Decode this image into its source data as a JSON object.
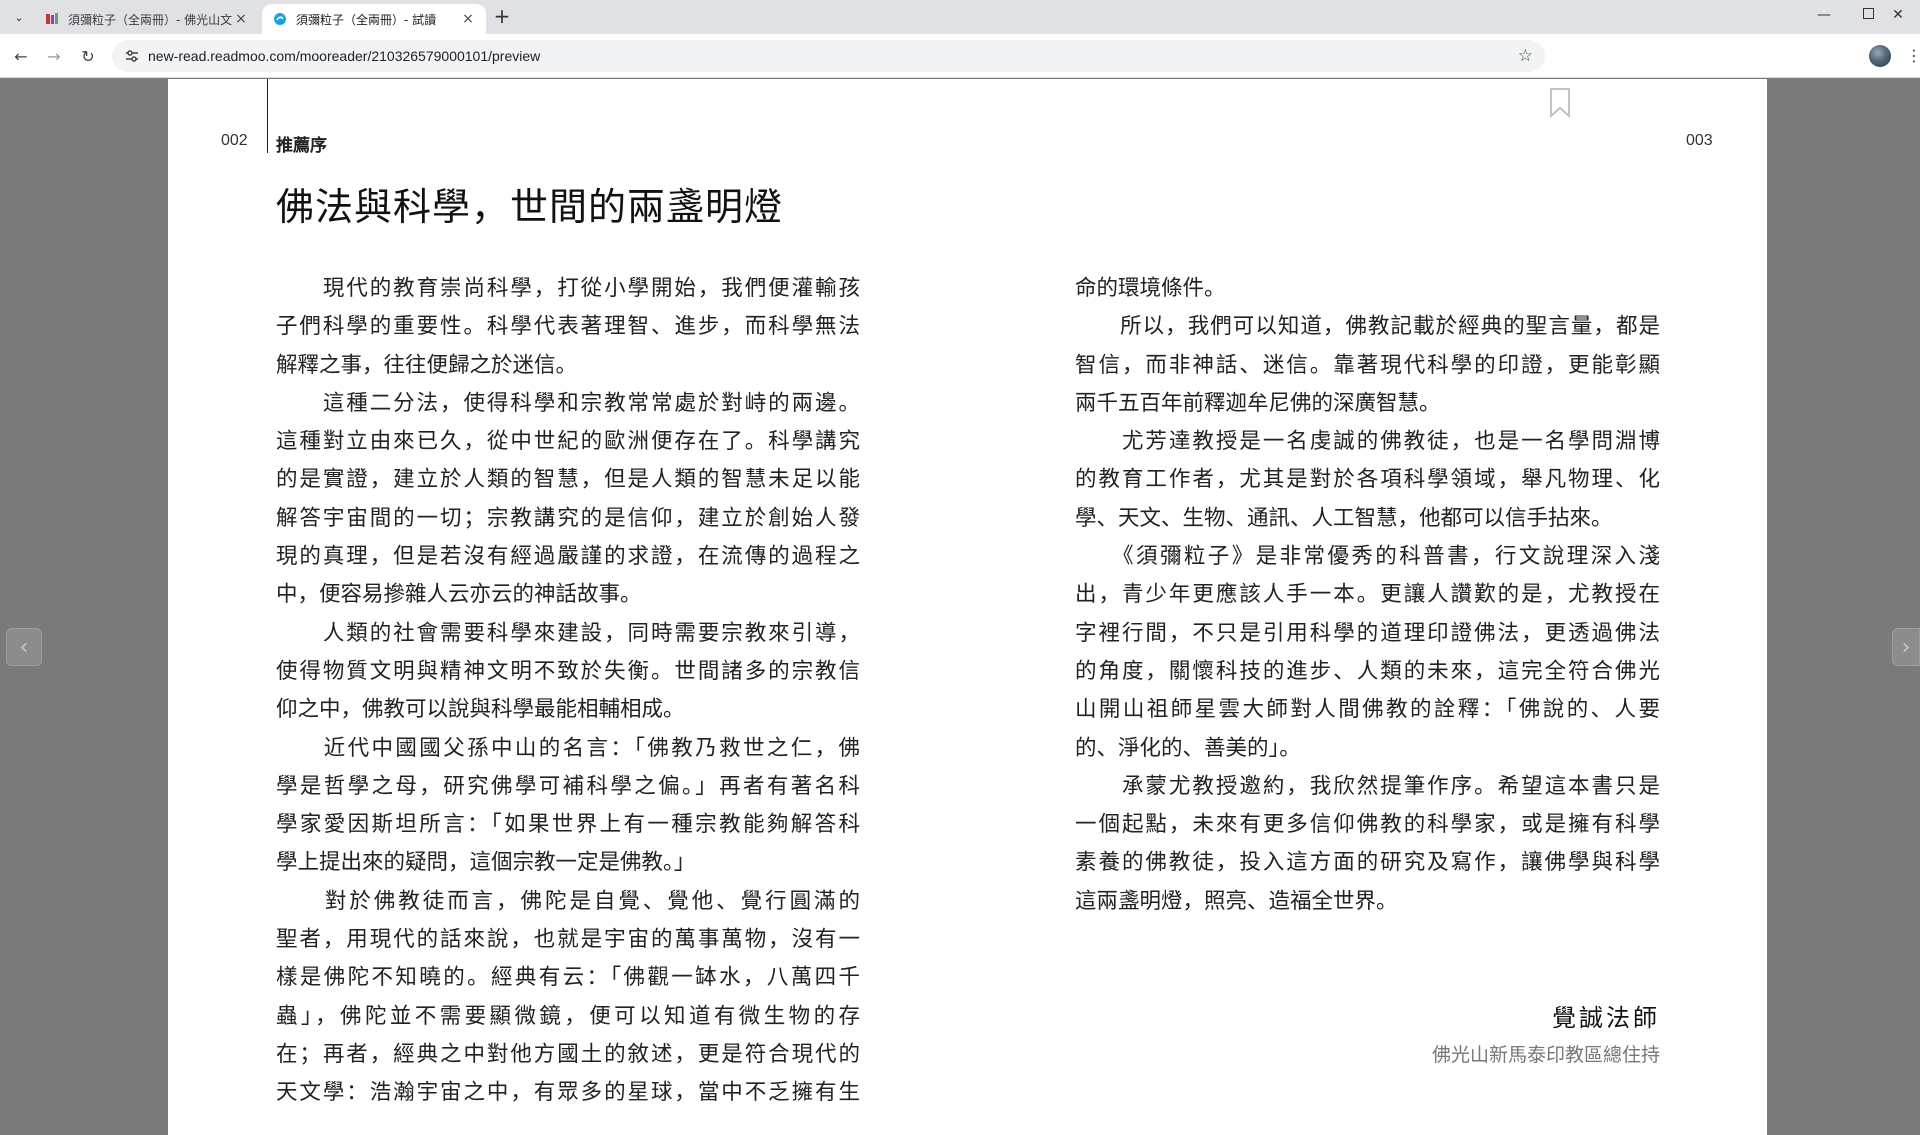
{
  "browser": {
    "tabs": [
      {
        "title": "須彌粒子（全兩冊）- 佛光山文",
        "active": false
      },
      {
        "title": "須彌粒子（全兩冊）- 試讀",
        "active": true
      }
    ],
    "url": "new-read.readmoo.com/mooreader/210326579000101/preview"
  },
  "reader": {
    "left_page_number": "002",
    "right_page_number": "003",
    "section_label": "推薦序",
    "chapter_title": "佛法與科學，世間的兩盞明燈",
    "left_column": [
      {
        "text": "　　現代的教育崇尚科學，打從小學開始，我們便灌輸孩",
        "short": false
      },
      {
        "text": "子們科學的重要性。科學代表著理智、進步，而科學無法",
        "short": false
      },
      {
        "text": "解釋之事，往往便歸之於迷信。",
        "short": true
      },
      {
        "text": "　　這種二分法，使得科學和宗教常常處於對峙的兩邊。",
        "short": false
      },
      {
        "text": "這種對立由來已久，從中世紀的歐洲便存在了。科學講究",
        "short": false
      },
      {
        "text": "的是實證，建立於人類的智慧，但是人類的智慧未足以能",
        "short": false
      },
      {
        "text": "解答宇宙間的一切；宗教講究的是信仰，建立於創始人發",
        "short": false
      },
      {
        "text": "現的真理，但是若沒有經過嚴謹的求證，在流傳的過程之",
        "short": false
      },
      {
        "text": "中，便容易摻雜人云亦云的神話故事。",
        "short": true
      },
      {
        "text": "　　人類的社會需要科學來建設，同時需要宗教來引導，",
        "short": false
      },
      {
        "text": "使得物質文明與精神文明不致於失衡。世間諸多的宗教信",
        "short": false
      },
      {
        "text": "仰之中，佛教可以說與科學最能相輔相成。",
        "short": true
      },
      {
        "text": "　　近代中國國父孫中山的名言：「佛教乃救世之仁，佛",
        "short": false
      },
      {
        "text": "學是哲學之母，研究佛學可補科學之偏。」再者有著名科",
        "short": false
      },
      {
        "text": "學家愛因斯坦所言：「如果世界上有一種宗教能夠解答科",
        "short": false
      },
      {
        "text": "學上提出來的疑問，這個宗教一定是佛教。」",
        "short": true
      },
      {
        "text": "　　對於佛教徒而言，佛陀是自覺、覺他、覺行圓滿的",
        "short": false
      },
      {
        "text": "聖者，用現代的話來說，也就是宇宙的萬事萬物，沒有一",
        "short": false
      },
      {
        "text": "樣是佛陀不知曉的。經典有云：「佛觀一缽水，八萬四千",
        "short": false
      },
      {
        "text": "蟲」，佛陀並不需要顯微鏡，便可以知道有微生物的存",
        "short": false
      },
      {
        "text": "在；再者，經典之中對他方國土的敘述，更是符合現代的",
        "short": false
      },
      {
        "text": "天文學：浩瀚宇宙之中，有眾多的星球，當中不乏擁有生",
        "short": false
      }
    ],
    "right_column": [
      {
        "text": "命的環境條件。",
        "short": true
      },
      {
        "text": "　　所以，我們可以知道，佛教記載於經典的聖言量，都是",
        "short": false
      },
      {
        "text": "智信，而非神話、迷信。靠著現代科學的印證，更能彰顯",
        "short": false
      },
      {
        "text": "兩千五百年前釋迦牟尼佛的深廣智慧。",
        "short": true
      },
      {
        "text": "　　尤芳達教授是一名虔誠的佛教徒，也是一名學問淵博",
        "short": false
      },
      {
        "text": "的教育工作者，尤其是對於各項科學領域，舉凡物理、化",
        "short": false
      },
      {
        "text": "學、天文、生物、通訊、人工智慧，他都可以信手拈來。",
        "short": true
      },
      {
        "text": "　　《須彌粒子》是非常優秀的科普書，行文說理深入淺",
        "short": false
      },
      {
        "text": "出，青少年更應該人手一本。更讓人讚歎的是，尤教授在",
        "short": false
      },
      {
        "text": "字裡行間，不只是引用科學的道理印證佛法，更透過佛法",
        "short": false
      },
      {
        "text": "的角度，關懷科技的進步、人類的未來，這完全符合佛光",
        "short": false
      },
      {
        "text": "山開山祖師星雲大師對人間佛教的詮釋：「佛說的、人要",
        "short": false
      },
      {
        "text": "的、淨化的、善美的」。",
        "short": true
      },
      {
        "text": "　　承蒙尤教授邀約，我欣然提筆作序。希望這本書只是",
        "short": false
      },
      {
        "text": "一個起點，未來有更多信仰佛教的科學家，或是擁有科學",
        "short": false
      },
      {
        "text": "素養的佛教徒，投入這方面的研究及寫作，讓佛學與科學",
        "short": false
      },
      {
        "text": "這兩盞明燈，照亮、造福全世界。",
        "short": true
      }
    ],
    "signature_name": "覺誠法師",
    "signature_title": "佛光山新馬泰印教區總住持"
  },
  "colors": {
    "page_background": "#ffffff",
    "reader_background": "#7a7a7a",
    "tab_strip": "#dfe1e5"
  }
}
